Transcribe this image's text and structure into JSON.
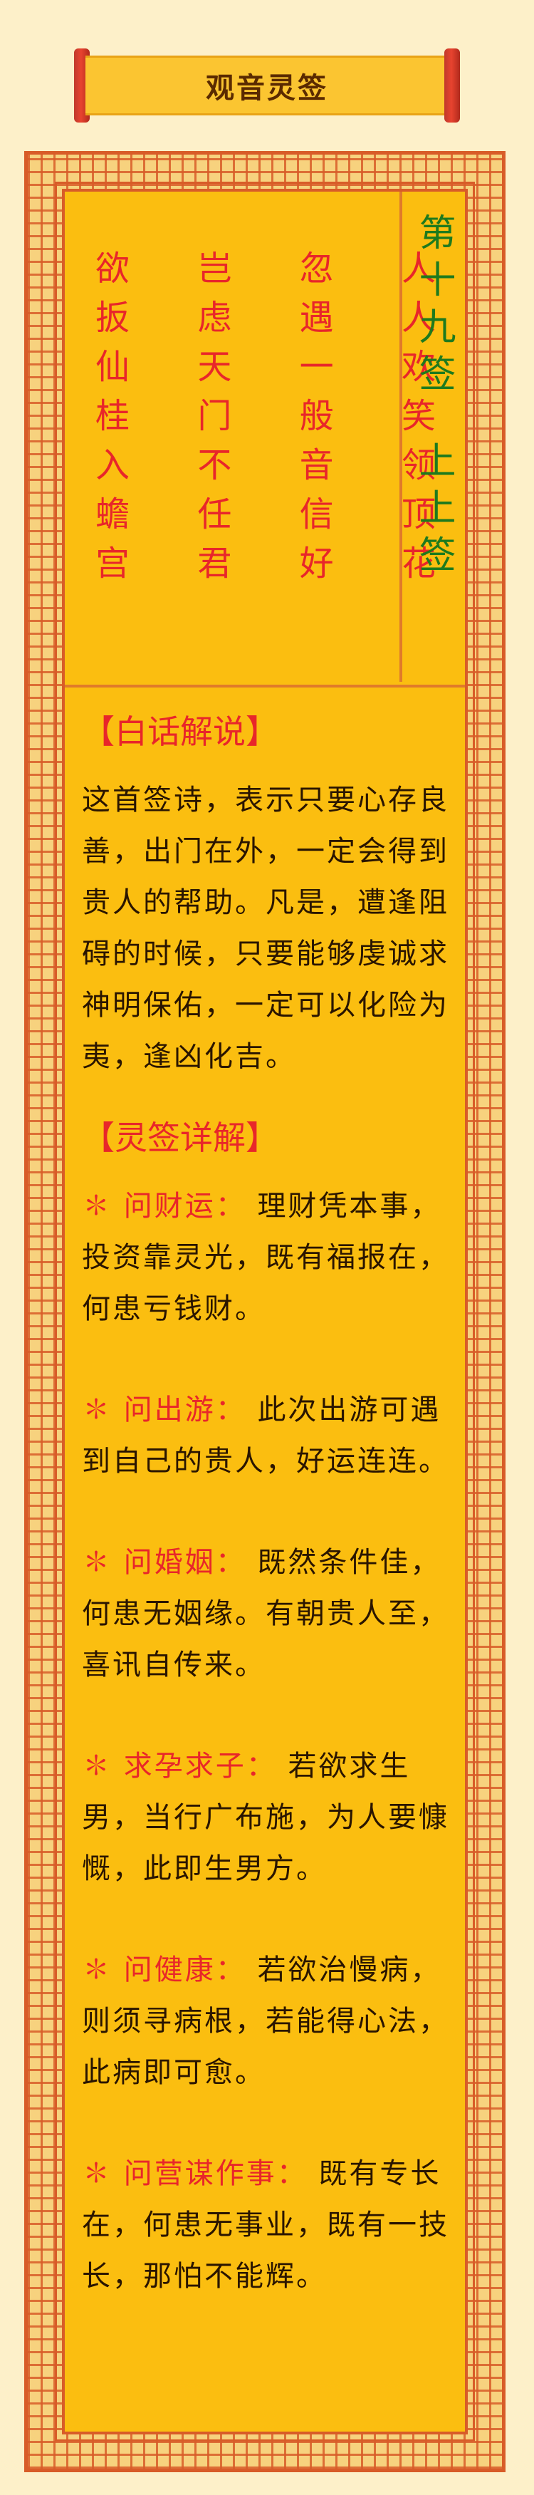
{
  "header": {
    "title": "观音灵签"
  },
  "poem": {
    "columns": [
      "人人欢笑领顶花",
      "忽遇一般音信好",
      "岂虑天门不任君",
      "欲扳仙桂入蟾宫"
    ],
    "sign_number": "第十九签",
    "sign_level": "上上签"
  },
  "explanation": {
    "heading": "【白话解说】",
    "text": "这首签诗，表示只要心存良善，出门在外，一定会得到贵人的帮助。凡是，遭逢阻碍的时候，只要能够虔诚求神明保佑，一定可以化险为夷，逢凶化吉。"
  },
  "details": {
    "heading": "【灵签详解】",
    "items": [
      {
        "star": "✽",
        "label": "问财运：",
        "text": "理财凭本事，投资靠灵光，既有福报在，何患亏钱财。"
      },
      {
        "star": "✽",
        "label": "问出游：",
        "text": "此次出游可遇到自己的贵人，好运连连。"
      },
      {
        "star": "✽",
        "label": "问婚姻：",
        "text": "既然条件佳，何患无姻缘。有朝贵人至，喜讯自传来。"
      },
      {
        "star": "✽",
        "label": "求孕求子：",
        "text": "若欲求生男，当行广布施，为人要慷慨，此即生男方。"
      },
      {
        "star": "✽",
        "label": "问健康：",
        "text": "若欲治慢病，则须寻病根，若能得心法，此病即可愈。"
      },
      {
        "star": "✽",
        "label": "问营谋作事：",
        "text": "既有专长在，何患无事业，既有一技长，那怕不能辉。"
      }
    ]
  }
}
